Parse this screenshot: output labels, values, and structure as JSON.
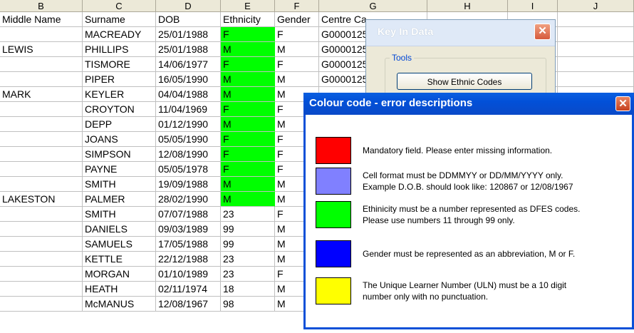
{
  "sheet": {
    "columns": [
      "B",
      "C",
      "D",
      "E",
      "F",
      "G",
      "H",
      "I",
      "J"
    ],
    "headers": [
      "Middle Name",
      "Surname",
      "DOB",
      "Ethnicity",
      "Gender",
      "Centre Ca"
    ],
    "rows": [
      {
        "middle": "",
        "surname": "MACREADY",
        "dob": "25/01/1988",
        "eth": "F",
        "gender": "F",
        "centre": "G0000125",
        "green": true
      },
      {
        "middle": "LEWIS",
        "surname": "PHILLIPS",
        "dob": "25/01/1988",
        "eth": "M",
        "gender": "M",
        "centre": "G0000125",
        "green": true
      },
      {
        "middle": "",
        "surname": "TISMORE",
        "dob": "14/06/1977",
        "eth": "F",
        "gender": "F",
        "centre": "G0000125",
        "green": true
      },
      {
        "middle": "",
        "surname": "PIPER",
        "dob": "16/05/1990",
        "eth": "M",
        "gender": "M",
        "centre": "G0000125",
        "green": true
      },
      {
        "middle": "MARK",
        "surname": "KEYLER",
        "dob": "04/04/1988",
        "eth": "M",
        "gender": "M",
        "centre": "",
        "green": true
      },
      {
        "middle": "",
        "surname": "CROYTON",
        "dob": "11/04/1969",
        "eth": "F",
        "gender": "F",
        "centre": "",
        "green": true
      },
      {
        "middle": "",
        "surname": "DEPP",
        "dob": "01/12/1990",
        "eth": "M",
        "gender": "M",
        "centre": "",
        "green": true
      },
      {
        "middle": "",
        "surname": "JOANS",
        "dob": "05/05/1990",
        "eth": "F",
        "gender": "F",
        "centre": "",
        "green": true
      },
      {
        "middle": "",
        "surname": "SIMPSON",
        "dob": "12/08/1990",
        "eth": "F",
        "gender": "F",
        "centre": "",
        "green": true
      },
      {
        "middle": "",
        "surname": "PAYNE",
        "dob": "05/05/1978",
        "eth": "F",
        "gender": "F",
        "centre": "",
        "green": true
      },
      {
        "middle": "",
        "surname": "SMITH",
        "dob": "19/09/1988",
        "eth": "M",
        "gender": "M",
        "centre": "",
        "green": true
      },
      {
        "middle": "LAKESTON",
        "surname": "PALMER",
        "dob": "28/02/1990",
        "eth": "M",
        "gender": "M",
        "centre": "",
        "green": true
      },
      {
        "middle": "",
        "surname": "SMITH",
        "dob": "07/07/1988",
        "eth": "23",
        "gender": "F",
        "centre": "",
        "green": false
      },
      {
        "middle": "",
        "surname": "DANIELS",
        "dob": "09/03/1989",
        "eth": "99",
        "gender": "M",
        "centre": "",
        "green": false
      },
      {
        "middle": "",
        "surname": "SAMUELS",
        "dob": "17/05/1988",
        "eth": "99",
        "gender": "M",
        "centre": "",
        "green": false
      },
      {
        "middle": "",
        "surname": "KETTLE",
        "dob": "22/12/1988",
        "eth": "23",
        "gender": "M",
        "centre": "",
        "green": false
      },
      {
        "middle": "",
        "surname": "MORGAN",
        "dob": "01/10/1989",
        "eth": "23",
        "gender": "F",
        "centre": "",
        "green": false
      },
      {
        "middle": "",
        "surname": "HEATH",
        "dob": "02/11/1974",
        "eth": "18",
        "gender": "M",
        "centre": "",
        "green": false
      },
      {
        "middle": "",
        "surname": "McMANUS",
        "dob": "12/08/1967",
        "eth": "98",
        "gender": "M",
        "centre": "",
        "green": false
      }
    ],
    "highlight_color": "#00ff00"
  },
  "keyin": {
    "title": "Key In Data",
    "group_label": "Tools",
    "button_label": "Show Ethnic Codes",
    "close_icon": "close-icon"
  },
  "colour_window": {
    "title": "Colour code - error descriptions",
    "close_icon": "close-icon",
    "items": [
      {
        "color": "#ff0000",
        "text": "Mandatory field.  Please enter missing information."
      },
      {
        "color": "#8080ff",
        "text": "Cell format must be DDMMYY or DD/MM/YYYY only.\nExample D.O.B. should look like: 120867 or 12/08/1967"
      },
      {
        "color": "#00ff00",
        "text": "Ethinicity must be a number represented as DFES codes.\nPlease use numbers 11 through 99 only."
      },
      {
        "color": "#0000ff",
        "text": "Gender must be represented as an abbreviation, M or F."
      },
      {
        "color": "#ffff00",
        "text": "The Unique Learner Number (ULN) must be a 10 digit\nnumber only with no punctuation."
      }
    ]
  }
}
